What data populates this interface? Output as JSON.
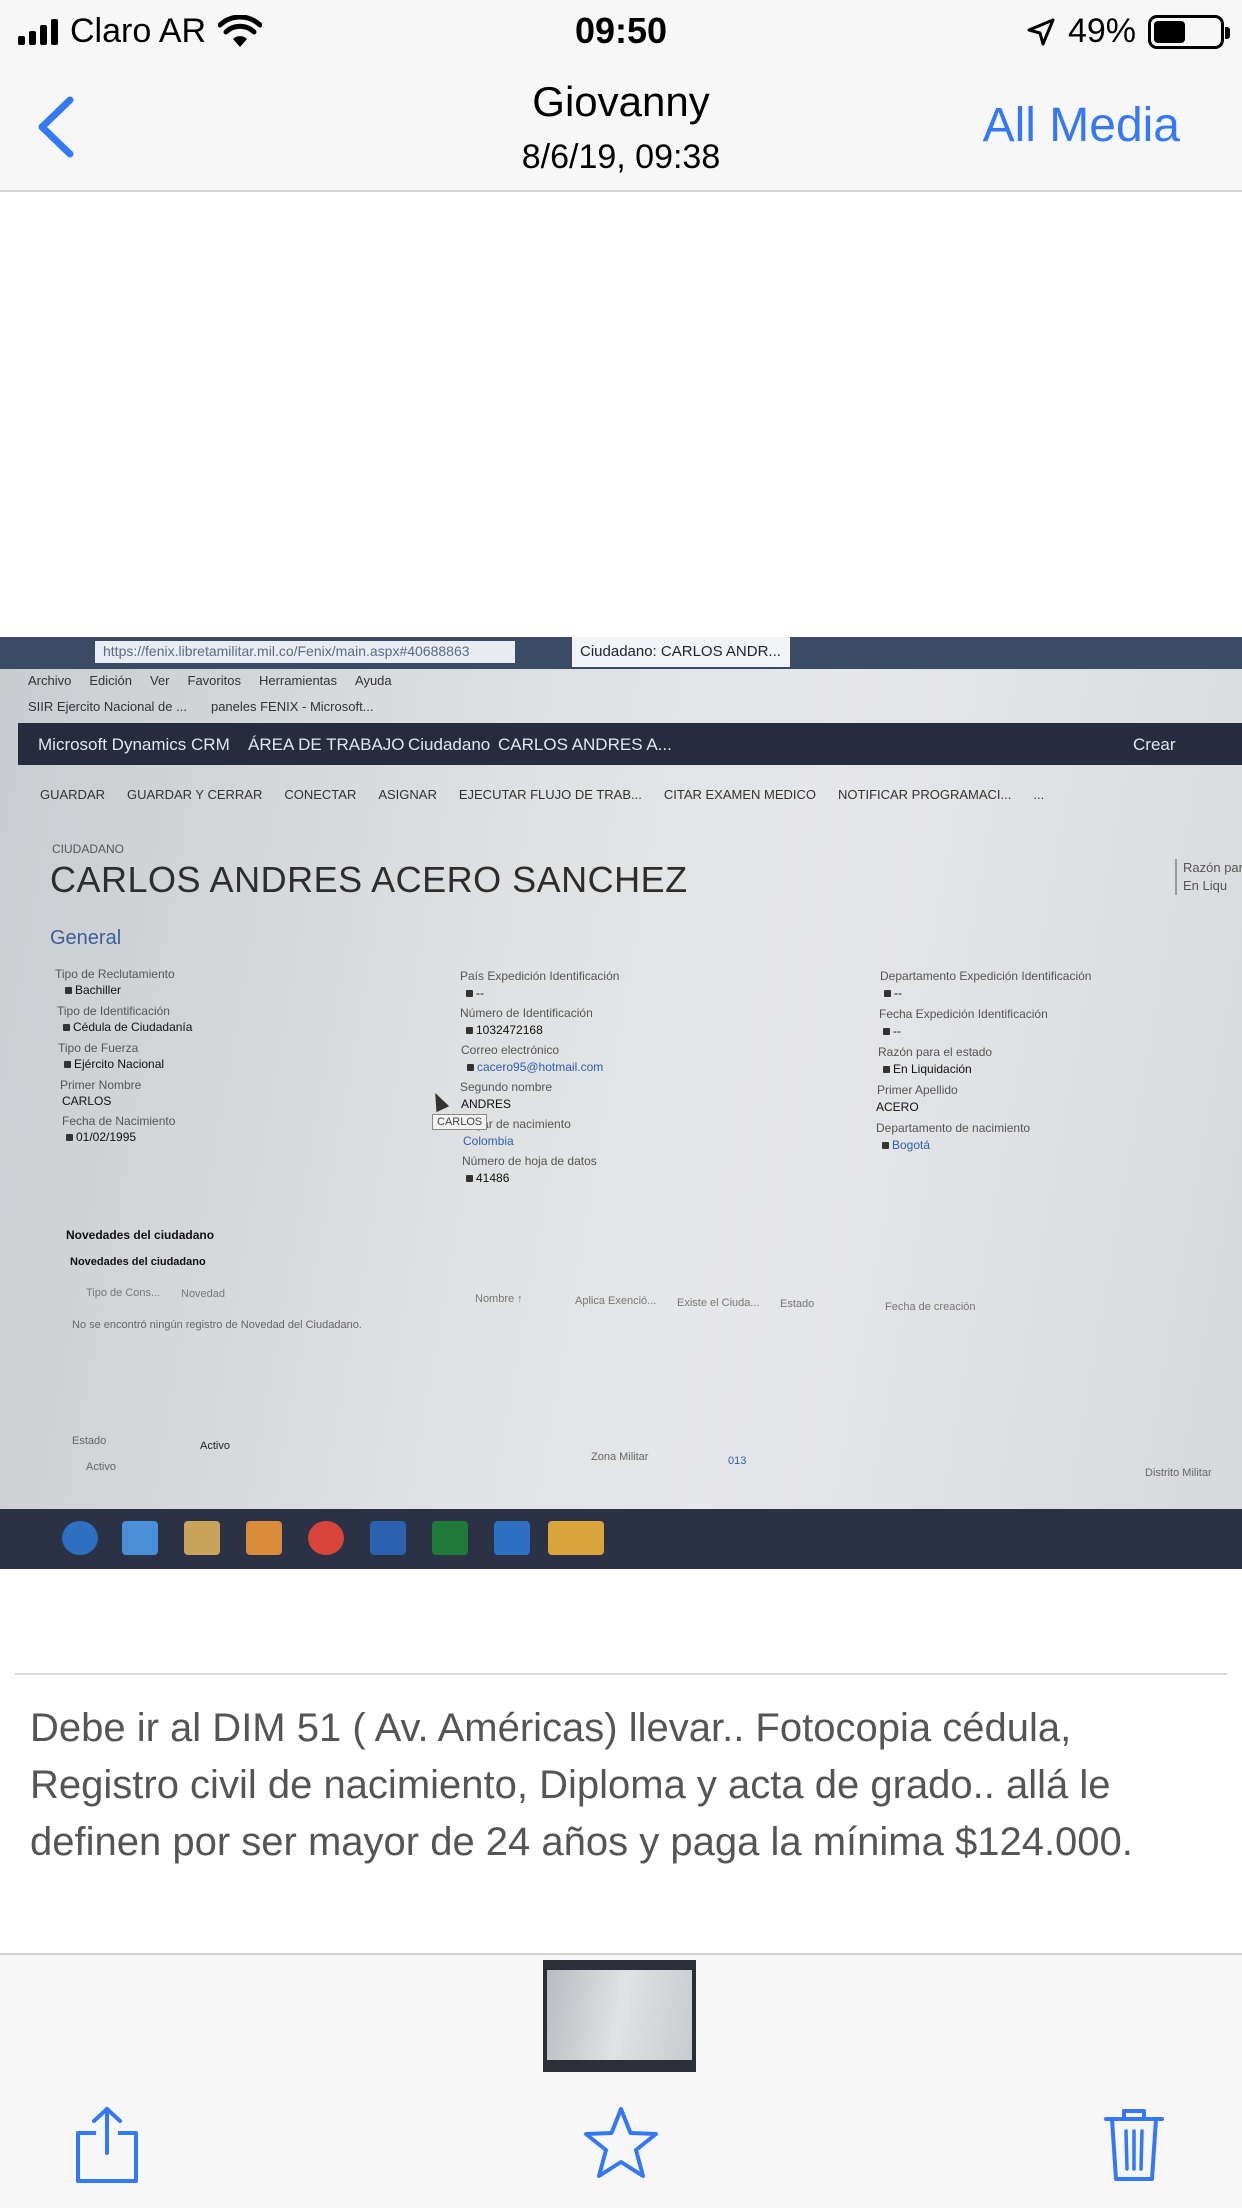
{
  "status_bar": {
    "carrier": "Claro AR",
    "time": "09:50",
    "battery_percent": "49%",
    "battery_level": 0.49,
    "icons": [
      "signal-icon",
      "wifi-icon",
      "location-arrow-icon",
      "battery-icon"
    ]
  },
  "nav": {
    "title": "Giovanny",
    "subtitle": "8/6/19, 09:38",
    "back_icon": "chevron-left-icon",
    "all_media_label": "All Media",
    "accent_color": "#3478f6"
  },
  "photo": {
    "browser": {
      "url": "https://fenix.libretamilitar.mil.co/Fenix/main.aspx#40688863",
      "tab_title": "Ciudadano: CARLOS ANDR...",
      "menu": [
        "Archivo",
        "Edición",
        "Ver",
        "Favoritos",
        "Herramientas",
        "Ayuda"
      ],
      "favorites": [
        "SIIR Ejercito Nacional de ...",
        "paneles FENIX - Microsoft..."
      ]
    },
    "crm": {
      "app_name": "Microsoft Dynamics CRM",
      "nav_items": [
        "ÁREA DE TRABAJO",
        "Ciudadano",
        "CARLOS ANDRES A..."
      ],
      "create_label": "Crear",
      "commands": [
        "GUARDAR",
        "GUARDAR Y CERRAR",
        "CONECTAR",
        "ASIGNAR",
        "EJECUTAR FLUJO DE TRAB...",
        "CITAR EXAMEN MEDICO",
        "NOTIFICAR PROGRAMACI...",
        "..."
      ],
      "record_type": "CIUDADANO",
      "record_name": "CARLOS ANDRES ACERO SANCHEZ",
      "header_razon_label": "Razón para",
      "header_razon_value": "En Liqu",
      "section_title": "General",
      "col1": [
        {
          "label": "Tipo de Reclutamiento",
          "value": "Bachiller"
        },
        {
          "label": "Tipo de Identificación",
          "value": "Cédula de Ciudadanía"
        },
        {
          "label": "Tipo de Fuerza",
          "value": "Ejército Nacional"
        },
        {
          "label": "Primer Nombre",
          "value": "CARLOS"
        },
        {
          "label": "Fecha de Nacimiento",
          "value": "01/02/1995"
        }
      ],
      "col2": [
        {
          "label": "País Expedición Identificación",
          "value": "--"
        },
        {
          "label": "Número de Identificación",
          "value": "1032472168"
        },
        {
          "label": "Correo electrónico",
          "value": "cacero95@hotmail.com"
        },
        {
          "label": "Segundo nombre",
          "value": "ANDRES"
        },
        {
          "label": "Lugar de nacimiento",
          "value": "Colombia"
        },
        {
          "label": "Número de hoja de datos",
          "value": "41486"
        }
      ],
      "col3": [
        {
          "label": "Departamento Expedición Identificación",
          "value": "--"
        },
        {
          "label": "Fecha Expedición Identificación",
          "value": "--"
        },
        {
          "label": "Razón para el estado",
          "value": "En Liquidación"
        },
        {
          "label": "Primer Apellido",
          "value": "ACERO"
        },
        {
          "label": "Departamento de nacimiento",
          "value": "Bogotá"
        }
      ],
      "tooltip": "CARLOS",
      "novedades_title": "Novedades del ciudadano",
      "novedades_subtitle": "Novedades del ciudadano",
      "grid_headers": [
        "Tipo de Cons...",
        "Novedad",
        "Nombre ↑",
        "Aplica Exenció...",
        "Existe el Ciuda...",
        "Estado",
        "Fecha de creación"
      ],
      "grid_empty": "No se encontró ningún registro de Novedad del Ciudadano.",
      "footer": {
        "estado_label": "Estado",
        "estado_value": "Activo",
        "activo": "Activo",
        "zona_label": "Zona Militar",
        "zona_value": "013",
        "distrito_label": "Distrito Militar"
      }
    }
  },
  "caption": "Debe ir al DIM 51 ( Av. Américas) llevar.. Fotocopia cédula, Registro civil de nacimiento, Diploma y acta de grado.. allá le definen por ser mayor de 24 años y paga la mínima $124.000.",
  "toolbar": {
    "share_icon": "share-icon",
    "favorite_icon": "star-icon",
    "delete_icon": "trash-icon",
    "icon_color": "#3478f6"
  }
}
